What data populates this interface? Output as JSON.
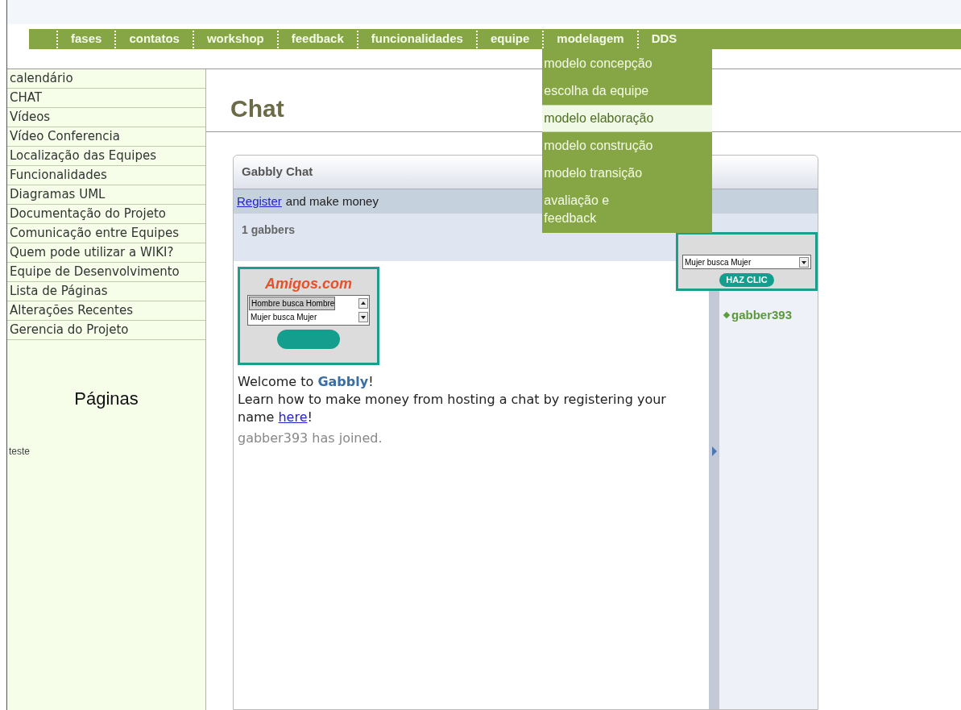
{
  "nav": {
    "items": [
      {
        "label": "fases"
      },
      {
        "label": "contatos"
      },
      {
        "label": "workshop"
      },
      {
        "label": "feedback"
      },
      {
        "label": "funcionalidades"
      },
      {
        "label": "equipe"
      },
      {
        "label": "modelagem",
        "menu": [
          {
            "label": "modelo concepção",
            "selected": false
          },
          {
            "label": "escolha da equipe",
            "selected": false
          },
          {
            "label": "modelo elaboração",
            "selected": true
          },
          {
            "label": "modelo construção",
            "selected": false
          },
          {
            "label": "modelo transição",
            "selected": false
          },
          {
            "label": "avaliação e feedback",
            "selected": false
          }
        ]
      },
      {
        "label": "DDS"
      }
    ]
  },
  "sidebar": {
    "items": [
      "calendário",
      "CHAT",
      "Vídeos",
      "Vídeo Conferencia",
      "Localização das Equipes",
      "Funcionalidades",
      "Diagramas UML",
      "Documentação do Projeto",
      "Comunicação entre Equipes",
      "Quem pode utilizar a WIKI?",
      "Equipe de Desenvolvimento",
      "Lista de Páginas",
      "Alterações Recentes",
      "Gerencia do Projeto"
    ],
    "pages_heading": "Páginas",
    "pages": [
      "teste"
    ]
  },
  "page_title": "Chat",
  "chat": {
    "title": "Gabbly Chat",
    "register_link": "Register",
    "register_text": "and make money",
    "gabbers": "1 gabbers",
    "left_ad": {
      "logo": "Amigos.com",
      "options": [
        "Hombre busca Hombre",
        "Mujer busca Mujer"
      ]
    },
    "right_ad": {
      "options": [
        "Mujer busca Mujer"
      ],
      "button": "HAZ CLIC"
    },
    "messages": [
      {
        "kind": "welcome",
        "lead": "Welcome to ",
        "brand": "Gabbly",
        "tail": "!"
      },
      {
        "kind": "link",
        "text": "Learn how to make money from hosting a chat by registering your name ",
        "link": "here",
        "tail": "!"
      },
      {
        "kind": "system",
        "text": "gabber393 has joined."
      }
    ],
    "users": [
      "gabber393"
    ]
  }
}
